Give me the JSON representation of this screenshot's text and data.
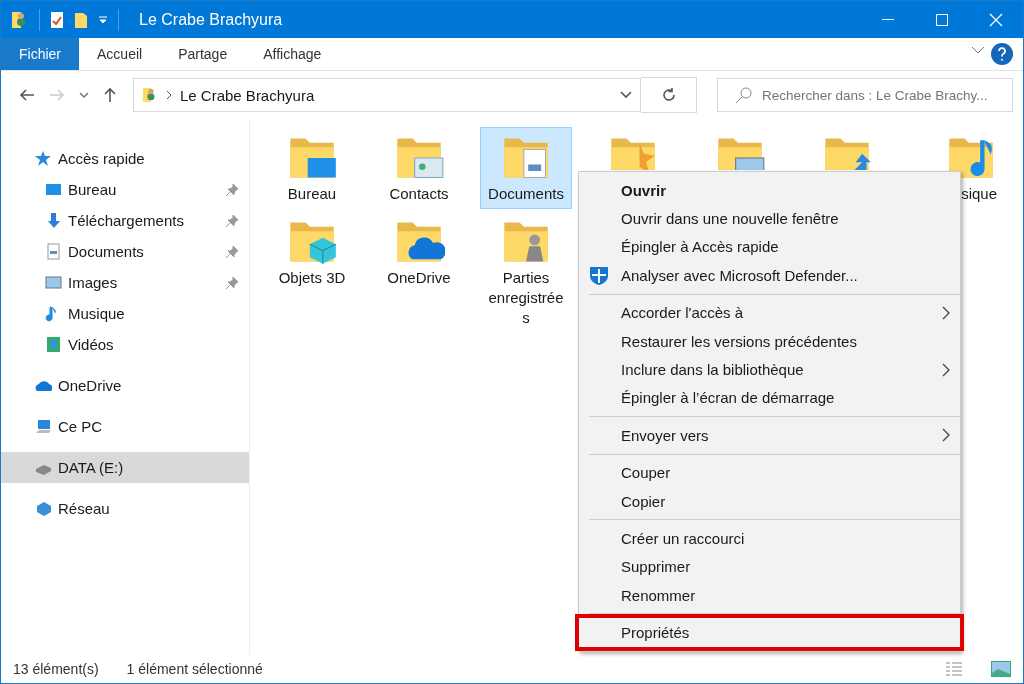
{
  "window": {
    "title": "Le Crabe Brachyura"
  },
  "ribbon": {
    "tabs": [
      {
        "label": "Fichier",
        "selected": true
      },
      {
        "label": "Accueil",
        "selected": false
      },
      {
        "label": "Partage",
        "selected": false
      },
      {
        "label": "Affichage",
        "selected": false
      }
    ]
  },
  "address_bar": {
    "path": "Le Crabe Brachyura"
  },
  "search": {
    "placeholder": "Rechercher dans : Le Crabe Brachy..."
  },
  "sidebar": {
    "items": [
      {
        "label": "Accès rapide",
        "selected": false,
        "children": [
          {
            "label": "Bureau",
            "selected": false,
            "pinned": true
          },
          {
            "label": "Téléchargements",
            "selected": false,
            "pinned": true
          },
          {
            "label": "Documents",
            "selected": false,
            "pinned": true
          },
          {
            "label": "Images",
            "selected": false,
            "pinned": true
          },
          {
            "label": "Musique",
            "selected": false,
            "pinned": false
          },
          {
            "label": "Vidéos",
            "selected": false,
            "pinned": false
          }
        ]
      },
      {
        "label": "OneDrive",
        "selected": false
      },
      {
        "label": "Ce PC",
        "selected": false
      },
      {
        "label": "DATA (E:)",
        "selected": true
      },
      {
        "label": "Réseau",
        "selected": false
      }
    ]
  },
  "files": [
    {
      "label": "Bureau",
      "selected": false
    },
    {
      "label": "Contacts",
      "selected": false
    },
    {
      "label": "Documents",
      "selected": true
    },
    {
      "selected": false
    },
    {
      "selected": false
    },
    {
      "selected": false
    },
    {
      "label": "sique",
      "selected": false
    },
    {
      "label": "Objets 3D",
      "selected": false
    },
    {
      "label": "OneDrive",
      "selected": false
    },
    {
      "label": "Parties enregistrée s",
      "selected": false
    }
  ],
  "context_menu": {
    "items": [
      {
        "kind": "item",
        "label": "Ouvrir",
        "bold": true,
        "submenu": false,
        "highlighted": false
      },
      {
        "kind": "item",
        "label": "Ouvrir dans une nouvelle fenêtre",
        "bold": false,
        "submenu": false,
        "highlighted": false
      },
      {
        "kind": "item",
        "label": "Épingler à Accès rapide",
        "bold": false,
        "submenu": false,
        "highlighted": false
      },
      {
        "kind": "item",
        "label": "Analyser avec Microsoft Defender...",
        "bold": false,
        "submenu": false,
        "highlighted": false,
        "shield": true
      },
      {
        "kind": "separator"
      },
      {
        "kind": "item",
        "label": "Accorder l'accès à",
        "bold": false,
        "submenu": true,
        "highlighted": false
      },
      {
        "kind": "item",
        "label": "Restaurer les versions précédentes",
        "bold": false,
        "submenu": false,
        "highlighted": false
      },
      {
        "kind": "item",
        "label": "Inclure dans la bibliothèque",
        "bold": false,
        "submenu": true,
        "highlighted": false
      },
      {
        "kind": "item",
        "label": "Épingler à l’écran de démarrage",
        "bold": false,
        "submenu": false,
        "highlighted": false
      },
      {
        "kind": "separator"
      },
      {
        "kind": "item",
        "label": "Envoyer vers",
        "bold": false,
        "submenu": true,
        "highlighted": false
      },
      {
        "kind": "separator"
      },
      {
        "kind": "item",
        "label": "Couper",
        "bold": false,
        "submenu": false,
        "highlighted": false
      },
      {
        "kind": "item",
        "label": "Copier",
        "bold": false,
        "submenu": false,
        "highlighted": false
      },
      {
        "kind": "separator"
      },
      {
        "kind": "item",
        "label": "Créer un raccourci",
        "bold": false,
        "submenu": false,
        "highlighted": false
      },
      {
        "kind": "item",
        "label": "Supprimer",
        "bold": false,
        "submenu": false,
        "highlighted": false
      },
      {
        "kind": "item",
        "label": "Renommer",
        "bold": false,
        "submenu": false,
        "highlighted": false
      },
      {
        "kind": "separator"
      },
      {
        "kind": "item",
        "label": "Propriétés",
        "bold": false,
        "submenu": false,
        "highlighted": true
      }
    ]
  },
  "status_bar": {
    "count": "13 élément(s)",
    "selection": "1 élément sélectionné"
  }
}
